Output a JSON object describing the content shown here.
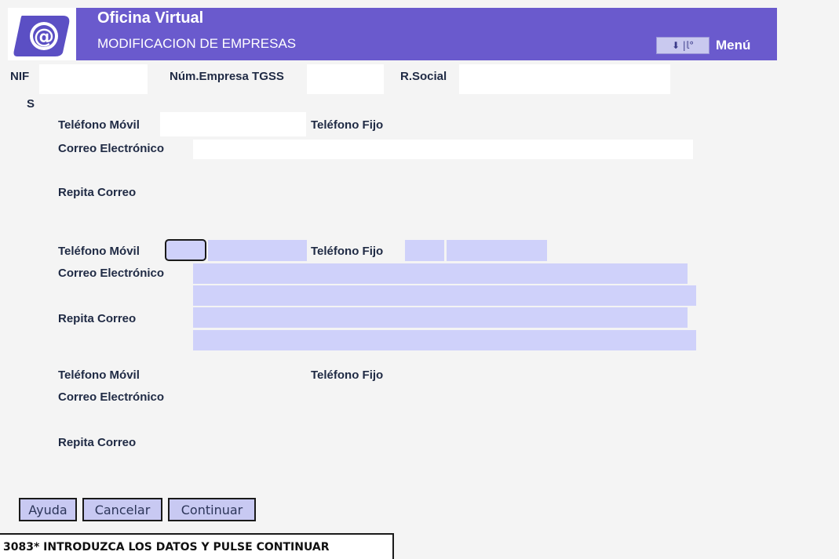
{
  "header": {
    "title": "Oficina Virtual",
    "subtitle": "MODIFICACION DE EMPRESAS",
    "menu_icons_glyph": "⬇ |𝕝°",
    "menu_label": "Menú",
    "logo_icon": "at-sign-logo"
  },
  "company": {
    "nif_label": "NIF",
    "num_empresa_label": "Núm.Empresa TGSS",
    "rsocial_label": "R.Social",
    "s_label": "S"
  },
  "contact_block_1": {
    "mobile_label": "Teléfono Móvil",
    "fixed_label": "Teléfono Fijo",
    "email_label": "Correo Electrónico",
    "repeat_label": "Repita Correo"
  },
  "contact_block_2": {
    "mobile_label": "Teléfono Móvil",
    "fixed_label": "Teléfono Fijo",
    "email_label": "Correo Electrónico",
    "repeat_label": "Repita Correo"
  },
  "contact_block_3": {
    "mobile_label": "Teléfono Móvil",
    "fixed_label": "Teléfono Fijo",
    "email_label": "Correo Electrónico",
    "repeat_label": "Repita Correo"
  },
  "buttons": {
    "help": "Ayuda",
    "cancel": "Cancelar",
    "continue": "Continuar"
  },
  "status": {
    "message": "3083* INTRODUZCA LOS DATOS Y PULSE CONTINUAR"
  },
  "colors": {
    "header_bg": "#6a5acd",
    "field_blue": "#cfd1fa",
    "button_bg": "#c8c9f2"
  }
}
